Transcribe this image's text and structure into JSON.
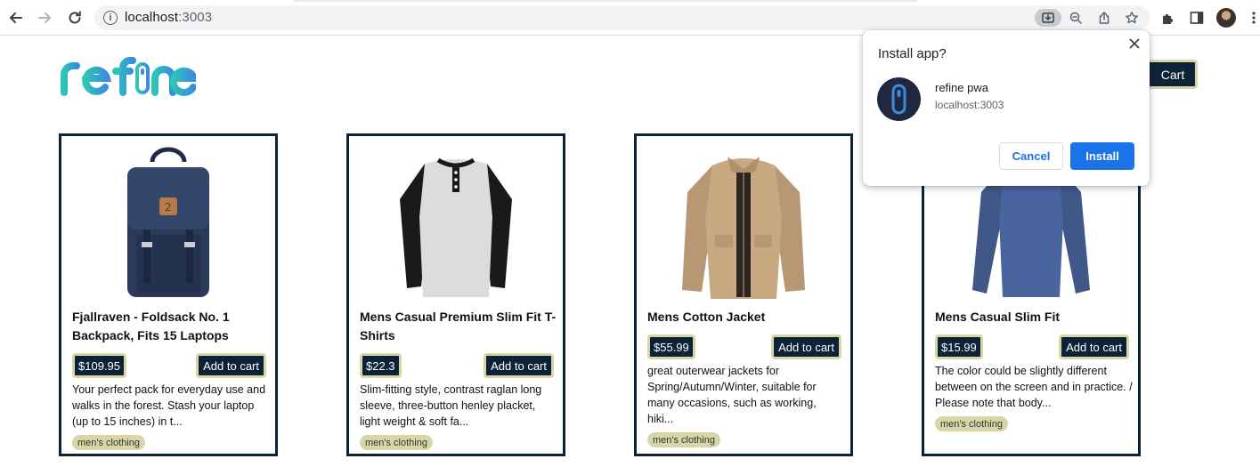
{
  "browser": {
    "url_host": "localhost",
    "url_port": ":3003",
    "info_icon": "info-icon",
    "icons": [
      "back-icon",
      "forward-icon",
      "reload-icon",
      "install-app-icon",
      "zoom-icon",
      "share-icon",
      "bookmark-star-icon",
      "extensions-icon",
      "side-panel-icon",
      "profile-avatar",
      "kebab-menu-icon"
    ]
  },
  "header": {
    "logo_alt": "refine",
    "cart_label": "Cart"
  },
  "products": [
    {
      "title": "Fjallraven - Foldsack No. 1 Backpack, Fits 15 Laptops",
      "price": "$109.95",
      "add_label": "Add to cart",
      "description": "Your perfect pack for everyday use and walks in the forest. Stash your laptop (up to 15 inches) in t...",
      "category": "men's clothing"
    },
    {
      "title": "Mens Casual Premium Slim Fit T-Shirts",
      "price": "$22.3",
      "add_label": "Add to cart",
      "description": "Slim-fitting style, contrast raglan long sleeve, three-button henley placket, light weight & soft fa...",
      "category": "men's clothing"
    },
    {
      "title": "Mens Cotton Jacket",
      "price": "$55.99",
      "add_label": "Add to cart",
      "description": "great outerwear jackets for Spring/Autumn/Winter, suitable for many occasions, such as working, hiki...",
      "category": "men's clothing"
    },
    {
      "title": "Mens Casual Slim Fit",
      "price": "$15.99",
      "add_label": "Add to cart",
      "description": "The color could be slightly different between on the screen and in practice. / Please note that body...",
      "category": "men's clothing"
    }
  ],
  "dialog": {
    "title": "Install app?",
    "close_icon": "close-icon",
    "app_name": "refine pwa",
    "app_host": "localhost:3003",
    "cancel_label": "Cancel",
    "install_label": "Install"
  },
  "colors": {
    "navy": "#0d2137",
    "khaki": "#d7d6a7",
    "chrome_blue": "#1a73e8",
    "logo_teal": "#2ec4b6",
    "logo_blue": "#3a8dde"
  }
}
